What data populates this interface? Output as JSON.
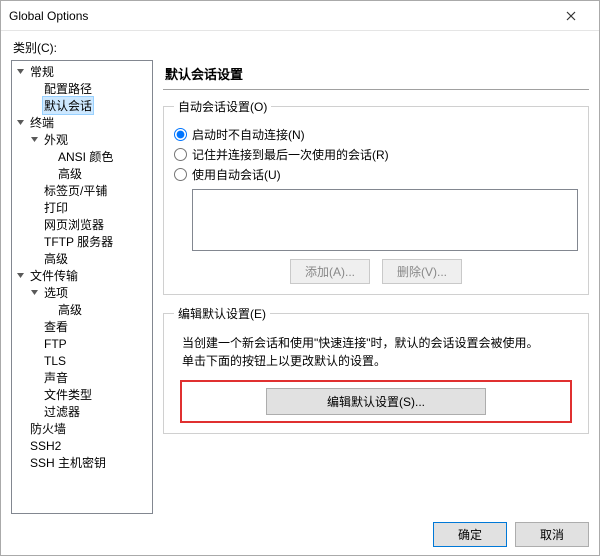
{
  "window": {
    "title": "Global Options"
  },
  "category_label": "类别(C):",
  "tree": {
    "general": {
      "label": "常规",
      "config_path": "配置路径",
      "default_session": "默认会话"
    },
    "terminal": {
      "label": "终端",
      "appearance": "外观",
      "ansi_color": "ANSI 颜色",
      "advanced": "高级",
      "tabs": "标签页/平铺",
      "print": "打印",
      "browser": "网页浏览器",
      "tftp": "TFTP 服务器",
      "adv2": "高级"
    },
    "file_transfer": {
      "label": "文件传输",
      "options": "选项",
      "advanced": "高级",
      "view": "查看",
      "ftp": "FTP",
      "tls": "TLS",
      "sound": "声音",
      "file_types": "文件类型",
      "filters": "过滤器"
    },
    "firewall": "防火墙",
    "ssh2": "SSH2",
    "ssh_hostkey": "SSH 主机密钥"
  },
  "page": {
    "title": "默认会话设置",
    "auto_group": {
      "legend": "自动会话设置(O)",
      "r1": "启动时不自动连接(N)",
      "r2": "记住并连接到最后一次使用的会话(R)",
      "r3": "使用自动会话(U)",
      "add": "添加(A)...",
      "delete": "删除(V)..."
    },
    "edit_group": {
      "legend": "编辑默认设置(E)",
      "desc1": "当创建一个新会话和使用\"快速连接\"时，默认的会话设置会被使用。",
      "desc2": "单击下面的按钮上以更改默认的设置。",
      "button": "编辑默认设置(S)..."
    }
  },
  "footer": {
    "ok": "确定",
    "cancel": "取消"
  }
}
